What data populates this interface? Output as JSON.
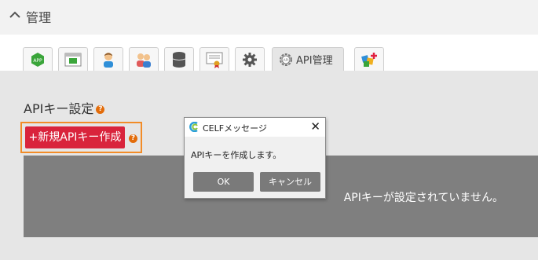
{
  "header": {
    "title": "管理"
  },
  "tabs": {
    "icons": [
      "app-badge-icon",
      "app-window-icon",
      "user-icon",
      "users-icon",
      "database-icon",
      "certificate-icon",
      "gear-icon",
      "api-gear-icon",
      "plugin-icon"
    ],
    "api_label": "API管理",
    "active": "API管理"
  },
  "section": {
    "title": "APIキー設定",
    "help_glyph": "?"
  },
  "new_key_button": {
    "label": "+新規APIキー作成"
  },
  "empty_panel": {
    "message": "APIキーが設定されていません。"
  },
  "dialog": {
    "title": "CELFメッセージ",
    "close_glyph": "✕",
    "message": "APIキーを作成します。",
    "ok_label": "OK",
    "cancel_label": "キャンセル"
  },
  "colors": {
    "accent_red": "#d9243c",
    "highlight_orange": "#f28c28",
    "help_orange": "#e36c0a",
    "panel_gray": "#7f7f7f",
    "dialog_button_gray": "#7a7a7a"
  }
}
